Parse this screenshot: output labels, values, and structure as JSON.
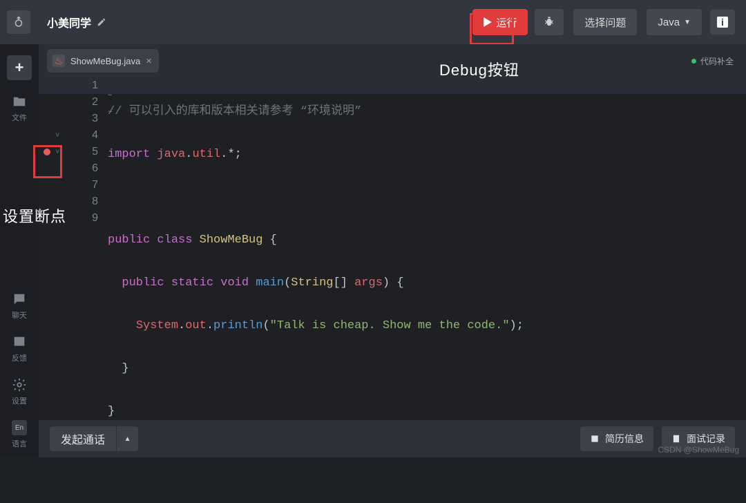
{
  "header": {
    "username": "小美同学",
    "run_label": "运行",
    "choose_label": "选择问题",
    "language_label": "Java",
    "info_label": "i"
  },
  "sidebar": {
    "add_label": "+",
    "files_label": "文件",
    "chat_label": "聊天",
    "feedback_label": "反馈",
    "settings_label": "设置",
    "language_label": "语言",
    "language_icon": "En"
  },
  "tabs": {
    "active": {
      "icon": "♨",
      "name": "ShowMeBug.java"
    }
  },
  "status": {
    "label": "代码补全"
  },
  "code": {
    "l1_comment": "// 可以引入的库和版本相关请参考 “环境说明”",
    "l2_import": "import",
    "l2_pkg1": "java",
    "l2_pkg2": "util",
    "l4_public": "public",
    "l4_class": "class",
    "l4_name": "ShowMeBug",
    "l5_public": "public",
    "l5_static": "static",
    "l5_void": "void",
    "l5_main": "main",
    "l5_type": "String",
    "l5_args": "args",
    "l6_sys": "System",
    "l6_out": "out",
    "l6_fn": "println",
    "l6_str": "\"Talk is cheap. Show me the code.\""
  },
  "line_numbers": [
    "1",
    "2",
    "3",
    "4",
    "5",
    "6",
    "7",
    "8",
    "9"
  ],
  "bottom": {
    "call_label": "发起通话",
    "resume_label": "简历信息",
    "record_label": "面试记录"
  },
  "annotations": {
    "debug_button": "Debug按钮",
    "breakpoint": "设置断点"
  },
  "watermark": "CSDN @ShowMeBug"
}
